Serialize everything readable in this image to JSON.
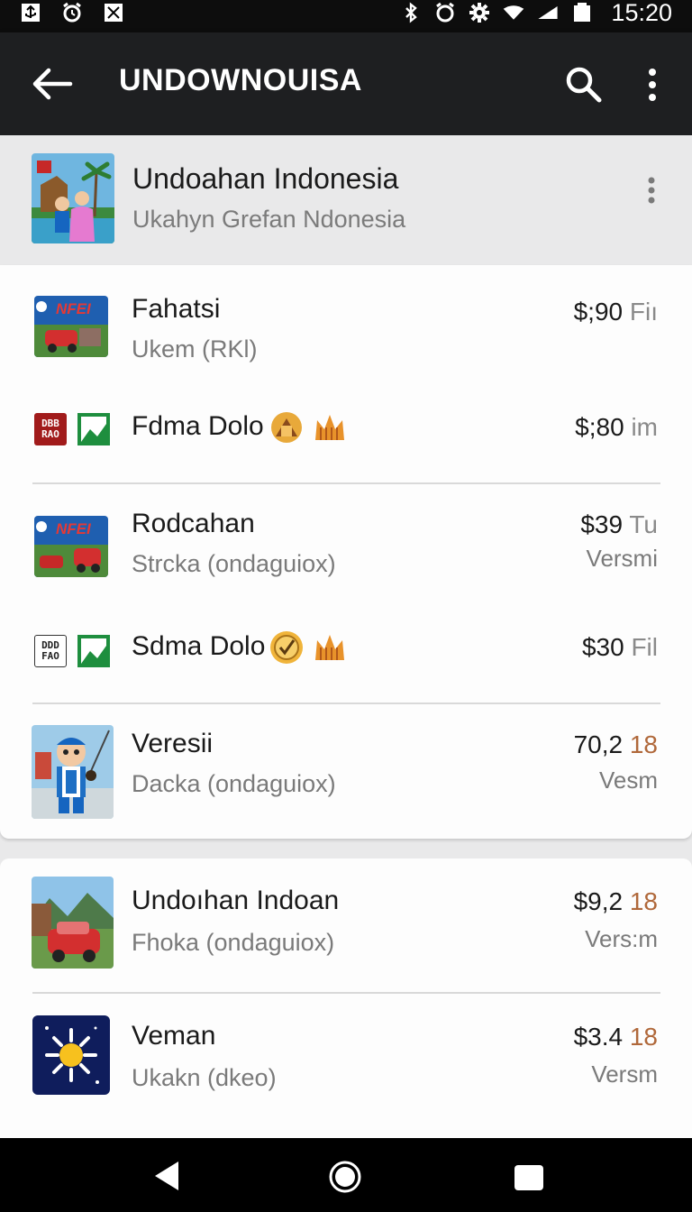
{
  "status_bar": {
    "time": "15:20",
    "left_icons": [
      "usb-icon",
      "alarm-icon",
      "no-signal-icon"
    ],
    "right_icons": [
      "bluetooth-icon",
      "alarm-icon",
      "settings-icon",
      "wifi-icon",
      "cell-signal-icon",
      "battery-icon"
    ]
  },
  "toolbar": {
    "title": "UNDOWNOUISA",
    "back_icon": "arrow-back-icon",
    "search_icon": "search-icon",
    "more_icon": "more-vert-icon"
  },
  "header": {
    "title": "Undoahan Indonesia",
    "subtitle": "Ukahyn Grefan Ndonesia",
    "more_icon": "more-vert-icon"
  },
  "list": {
    "items": [
      {
        "title": "Fahatsi",
        "subtitle": "Ukem (RKl)",
        "price": "$;90",
        "price_suffix": "Fiı",
        "version": ""
      },
      {
        "title": "Fdma Dolo",
        "subtitle": "",
        "price": "$;80",
        "price_suffix": "im",
        "version": ""
      },
      {
        "title": "Rodcahan",
        "subtitle": "Strcka (ondaguiox)",
        "price": "$39",
        "price_suffix": "Tu",
        "version": "Versmi"
      },
      {
        "title": "Sdma Dolo",
        "subtitle": "",
        "price": "$30",
        "price_suffix": "Fil",
        "version": ""
      },
      {
        "title": "Veresii",
        "subtitle": "Dacka (ondaguiox)",
        "price": "70,2",
        "price_suffix": "18",
        "version": "Vesm"
      },
      {
        "title": "Undoıhan Indoan",
        "subtitle": "Fhoka (ondaguiox)",
        "price": "$9,2",
        "price_suffix": "18",
        "version": "Vers:m"
      },
      {
        "title": "Veman",
        "subtitle": "Ukakn (dkeo)",
        "price": "$3.4",
        "price_suffix": "18",
        "version": "Versm"
      }
    ]
  },
  "mini_icons": {
    "dbb": "DBB\nRAO",
    "ddd": "DDD\nFAO"
  },
  "colors": {
    "toolbar_bg": "#1e1f21",
    "status_bg": "#0d0d0d",
    "accent_orange": "#b0683a",
    "nav_bg": "#000000"
  },
  "nav_bar": {
    "back_icon": "nav-back-icon",
    "home_icon": "nav-home-icon",
    "recents_icon": "nav-recents-icon"
  }
}
